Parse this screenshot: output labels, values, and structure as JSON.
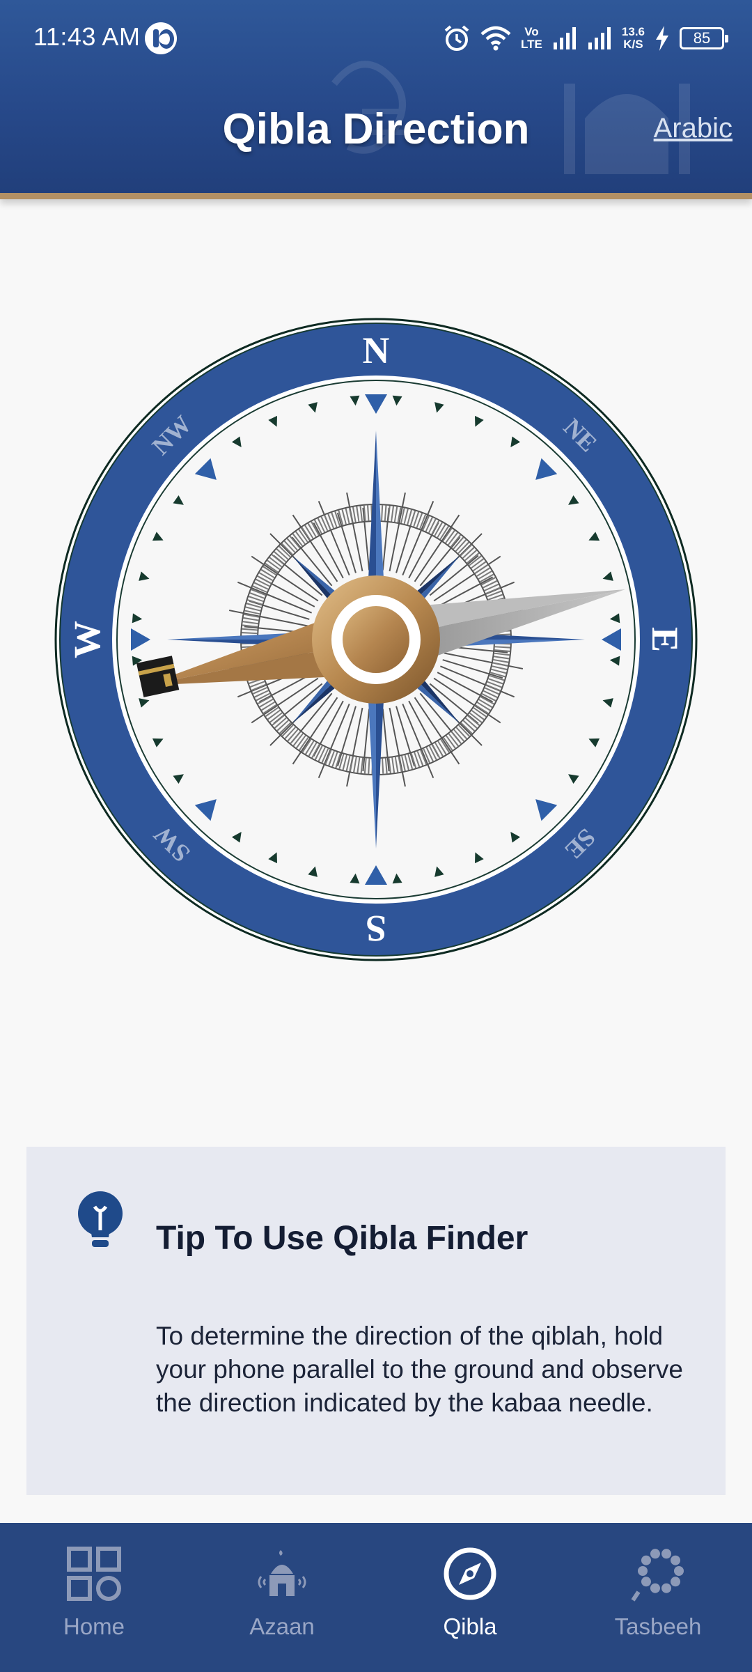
{
  "status_bar": {
    "time": "11:43 AM",
    "net_speed_value": "13.6",
    "net_speed_unit": "K/S",
    "volte_top": "Vo",
    "volte_bottom": "LTE",
    "battery_level": "85"
  },
  "header": {
    "title": "Qibla Direction",
    "language_link": "Arabic"
  },
  "compass": {
    "north": "N",
    "south": "S",
    "east": "E",
    "west": "W",
    "northeast": "NE",
    "northwest": "NW",
    "southeast": "SE",
    "southwest": "SW",
    "ring_color": "#2f5599",
    "needle_gold": "#c39a64",
    "needle_silver": "#a6a6a6"
  },
  "tip": {
    "title": "Tip To Use Qibla Finder",
    "body": "To determine the direction of the qiblah, hold your phone parallel to the ground and observe the direction indicated by the kabaa needle.",
    "icon": "lightbulb-icon"
  },
  "bottom_nav": {
    "items": [
      {
        "label": "Home",
        "icon": "grid-icon",
        "active": false
      },
      {
        "label": "Azaan",
        "icon": "mosque-icon",
        "active": false
      },
      {
        "label": "Qibla",
        "icon": "compass-icon",
        "active": true
      },
      {
        "label": "Tasbeeh",
        "icon": "tasbeeh-beads-icon",
        "active": false
      }
    ]
  }
}
